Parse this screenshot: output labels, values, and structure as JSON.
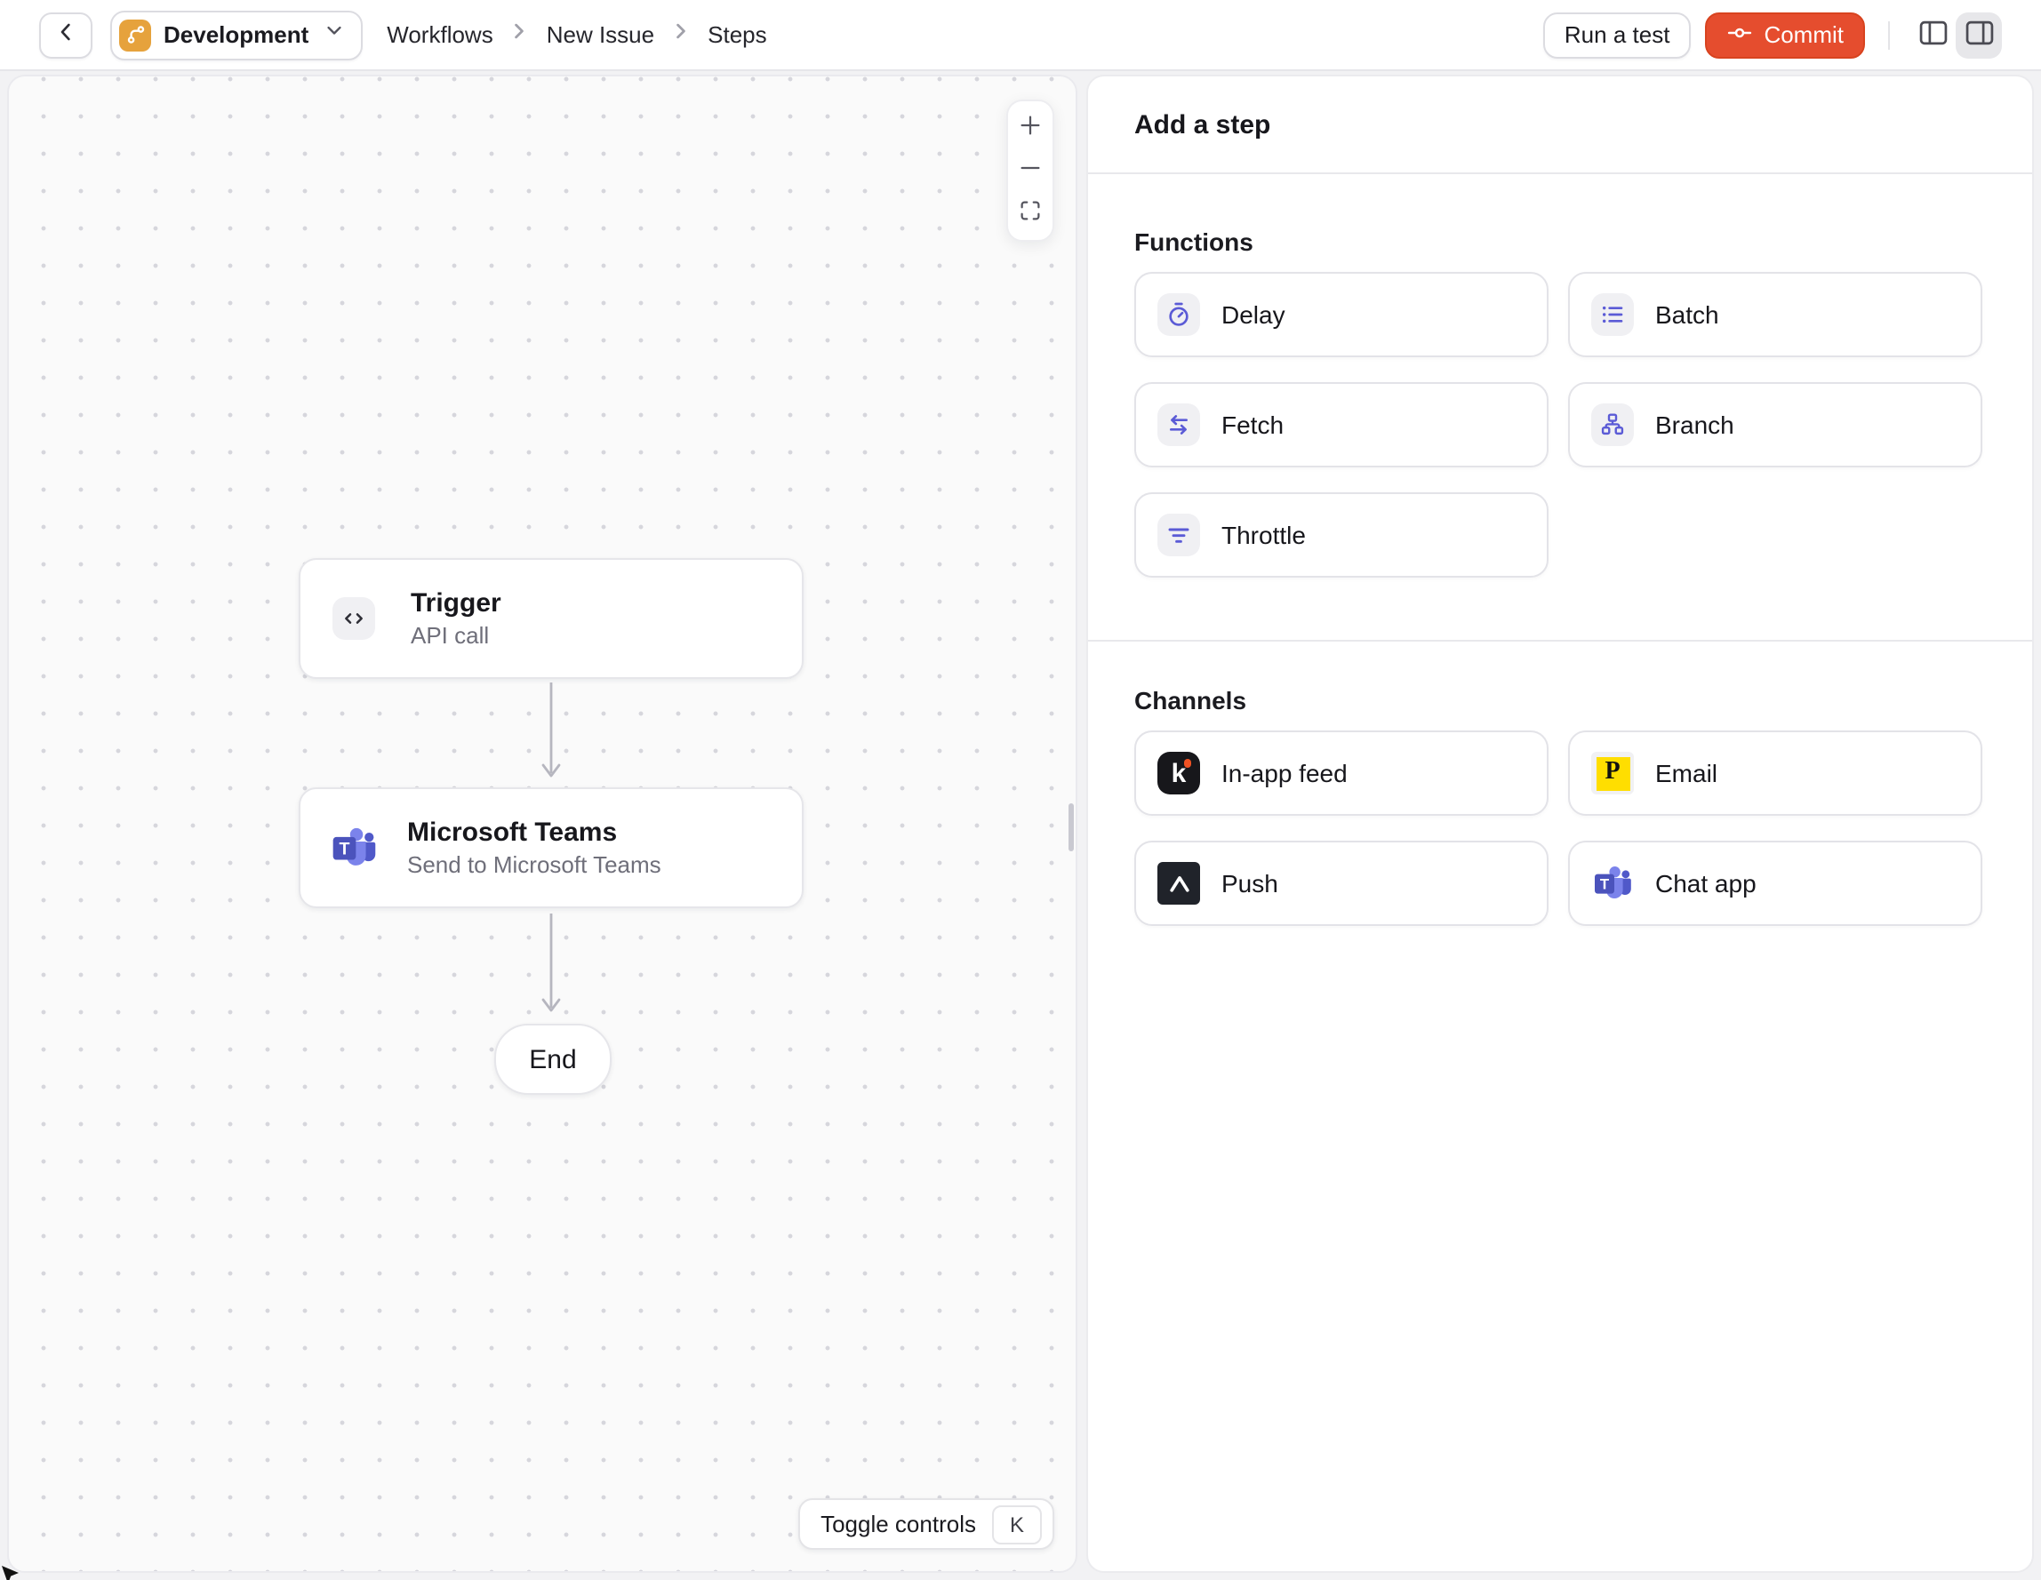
{
  "topbar": {
    "environment_label": "Development",
    "breadcrumb": [
      "Workflows",
      "New Issue",
      "Steps"
    ],
    "run_test_label": "Run a test",
    "commit_label": "Commit"
  },
  "canvas": {
    "nodes": {
      "trigger": {
        "title": "Trigger",
        "subtitle": "API call",
        "icon": "code-icon"
      },
      "teams": {
        "title": "Microsoft Teams",
        "subtitle": "Send to Microsoft Teams",
        "icon": "ms-teams-icon"
      },
      "end": {
        "label": "End"
      }
    },
    "zoom_controls": [
      "zoom-in",
      "zoom-out",
      "fit-view"
    ],
    "toggle_controls_label": "Toggle controls",
    "toggle_controls_shortcut": "K"
  },
  "panel": {
    "title": "Add a step",
    "functions_label": "Functions",
    "functions": [
      {
        "label": "Delay",
        "icon": "stopwatch-icon"
      },
      {
        "label": "Batch",
        "icon": "list-icon"
      },
      {
        "label": "Fetch",
        "icon": "swap-arrows-icon"
      },
      {
        "label": "Branch",
        "icon": "org-tree-icon"
      },
      {
        "label": "Throttle",
        "icon": "filter-lines-icon"
      }
    ],
    "channels_label": "Channels",
    "channels": [
      {
        "label": "In-app feed",
        "icon": "knock-icon"
      },
      {
        "label": "Email",
        "icon": "postmark-icon"
      },
      {
        "label": "Push",
        "icon": "expo-icon"
      },
      {
        "label": "Chat app",
        "icon": "ms-teams-icon"
      }
    ]
  },
  "colors": {
    "commit_accent": "#E54D2E",
    "environment_orange": "#E6A23C",
    "function_icon_indigo": "#5B5BD6",
    "postmark_yellow": "#FFDE00",
    "knock_dot_orange": "#F05223",
    "teams_purple": "#4B53BC"
  }
}
